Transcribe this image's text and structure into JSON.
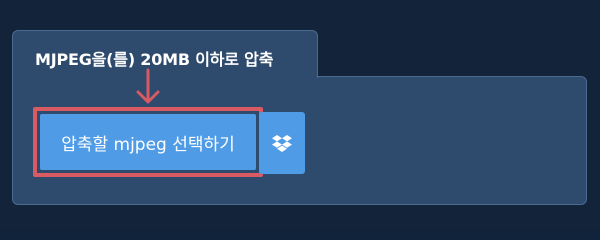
{
  "tab": {
    "title": "MJPEG을(를) 20MB 이하로 압축"
  },
  "upload": {
    "select_button_label": "압축할 mjpeg 선택하기",
    "dropbox_icon": "dropbox-icon"
  },
  "colors": {
    "background": "#12233a",
    "panel": "#2e4a6d",
    "button": "#4f9be6",
    "highlight": "#d85a63"
  }
}
